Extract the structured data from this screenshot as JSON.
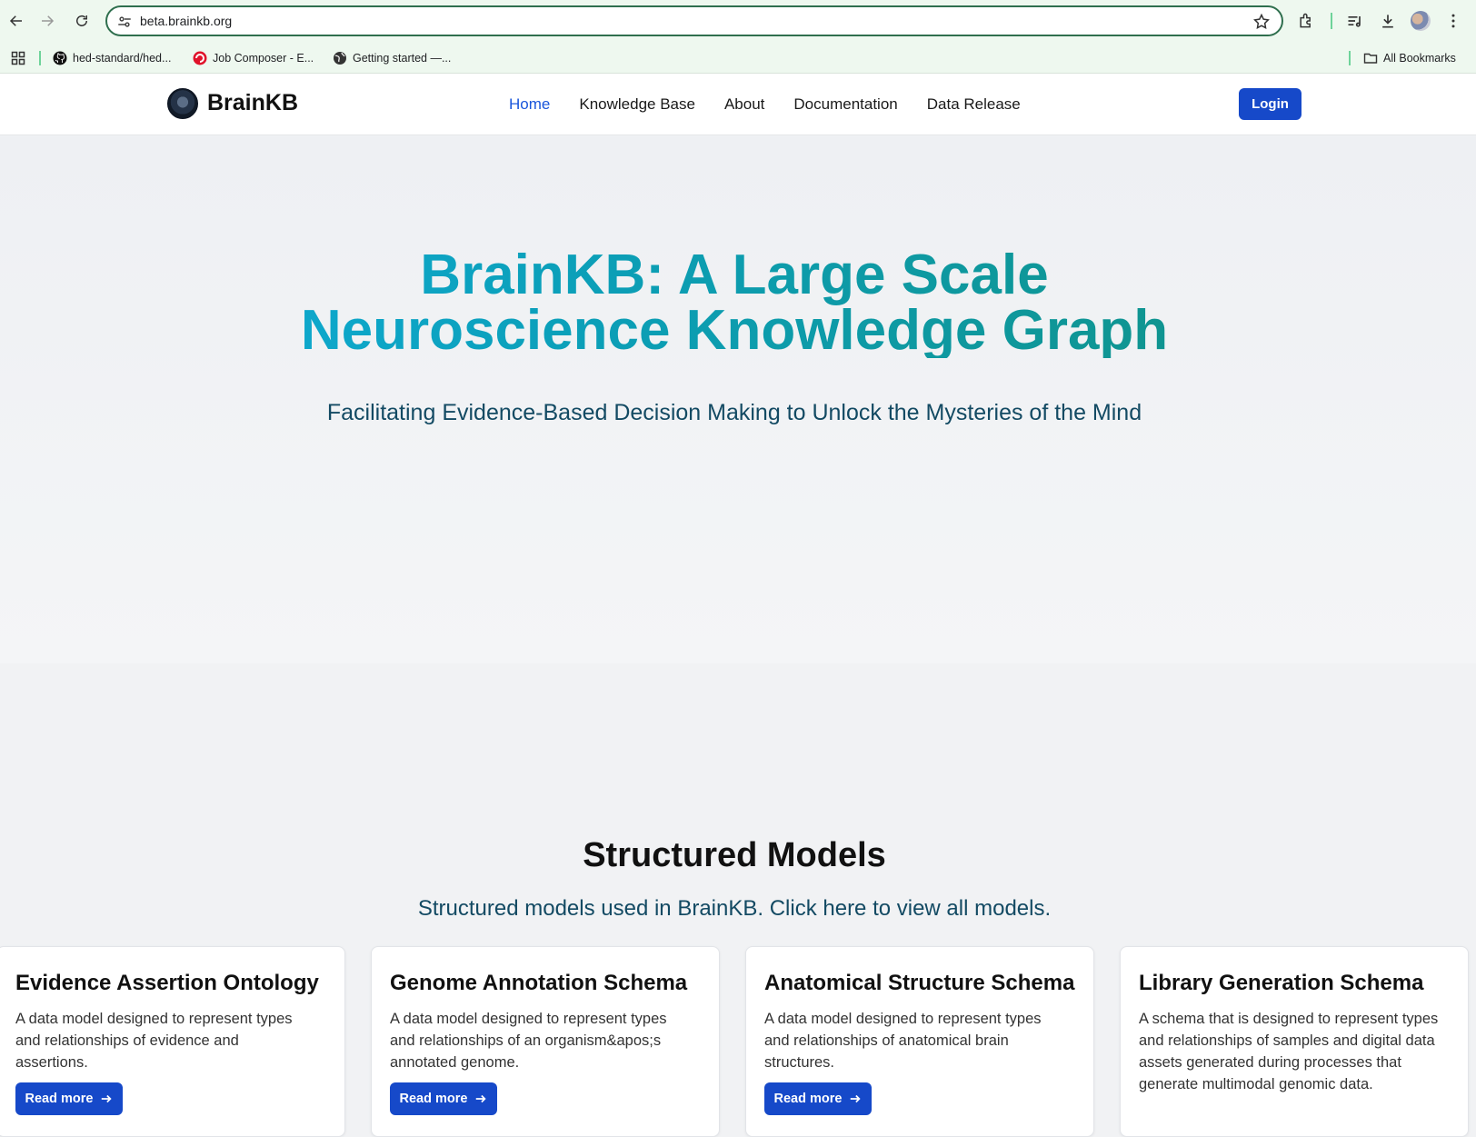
{
  "browser": {
    "url": "beta.brainkb.org",
    "bookmarks": [
      {
        "label": "hed-standard/hed...",
        "icon": "github-icon"
      },
      {
        "label": "Job Composer - E...",
        "icon": "job-composer-icon"
      },
      {
        "label": "Getting started —...",
        "icon": "globe-icon"
      }
    ],
    "all_bookmarks": "All Bookmarks"
  },
  "header": {
    "logo_text": "BrainKB",
    "nav": [
      "Home",
      "Knowledge Base",
      "About",
      "Documentation",
      "Data Release"
    ],
    "login": "Login"
  },
  "hero": {
    "title_line1": "BrainKB: A Large Scale",
    "title_line2": "Neuroscience Knowledge Graph",
    "tagline": "Facilitating Evidence-Based Decision Making to Unlock the Mysteries of the Mind"
  },
  "models": {
    "heading": "Structured Models",
    "subheading": "Structured models used in BrainKB. Click here to view all models.",
    "cards": [
      {
        "title": "Evidence Assertion Ontology",
        "description": "A data model designed to represent types and relationships of evidence and assertions.",
        "button": "Read more"
      },
      {
        "title": "Genome Annotation Schema",
        "description": "A data model designed to represent types and relationships of an organism&apos;s annotated genome.",
        "button": "Read more"
      },
      {
        "title": "Anatomical Structure Schema",
        "description": "A data model designed to represent types and relationships of anatomical brain structures.",
        "button": "Read more"
      },
      {
        "title": "Library Generation Schema",
        "description": "A schema that is designed to represent types and relationships of samples and digital data assets generated during processes that generate multimodal genomic data.",
        "button": ""
      }
    ]
  },
  "colors": {
    "primary_button": "#1649c9",
    "nav_active": "#1a56db",
    "title_gradient_start": "#0fb0df",
    "title_gradient_end": "#118f7c",
    "subtitle": "#134a63"
  }
}
